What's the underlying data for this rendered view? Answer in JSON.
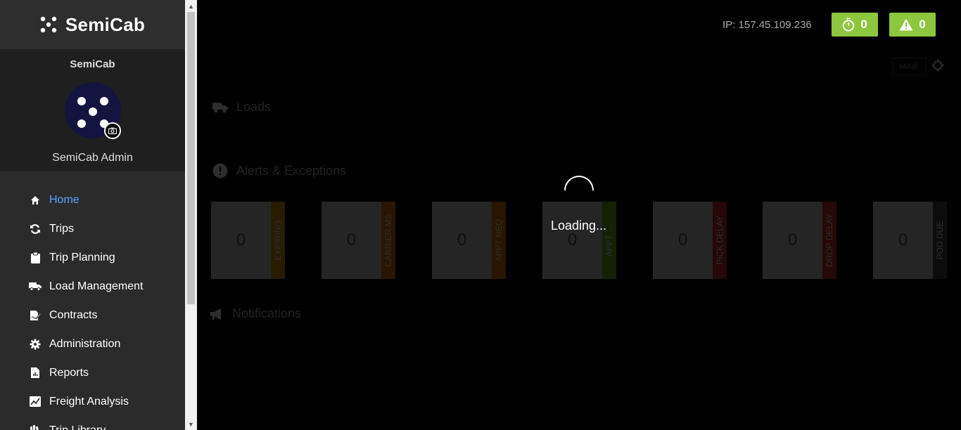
{
  "brand": {
    "name": "SemiCab"
  },
  "profile": {
    "org": "SemiCab",
    "user": "SemiCab Admin"
  },
  "nav": [
    {
      "label": "Home",
      "icon": "home-icon",
      "active": true
    },
    {
      "label": "Trips",
      "icon": "refresh-icon"
    },
    {
      "label": "Trip Planning",
      "icon": "clipboard-icon"
    },
    {
      "label": "Load Management",
      "icon": "truck-icon"
    },
    {
      "label": "Contracts",
      "icon": "contract-icon"
    },
    {
      "label": "Administration",
      "icon": "gear-icon"
    },
    {
      "label": "Reports",
      "icon": "report-icon"
    },
    {
      "label": "Freight Analysis",
      "icon": "chart-icon"
    },
    {
      "label": "Trip Library",
      "icon": "library-icon"
    }
  ],
  "header": {
    "ip": "IP: 157.45.109.236",
    "timer_count": "0",
    "alert_count": "0",
    "accent": "#8dc63f"
  },
  "filter": {
    "mine_label": "MINE"
  },
  "sections": {
    "loads": "Loads",
    "alerts": "Alerts & Exceptions",
    "notifications": "Notifications"
  },
  "cards": [
    {
      "count": "0",
      "label": "EXPIRING",
      "color": "#e0a100"
    },
    {
      "count": "0",
      "label": "CARRIER MS",
      "color": "#e07b00"
    },
    {
      "count": "0",
      "label": "APPT REQ",
      "color": "#e07b00"
    },
    {
      "count": "0",
      "label": "APPT …",
      "color": "#7ab51d"
    },
    {
      "count": "0",
      "label": "PICK DELAY",
      "color": "#d32f2f"
    },
    {
      "count": "0",
      "label": "DROP DELAY",
      "color": "#d32f2f"
    },
    {
      "count": "0",
      "label": "POD DUE",
      "color": "#444444"
    }
  ],
  "overlay": {
    "text": "Loading..."
  }
}
